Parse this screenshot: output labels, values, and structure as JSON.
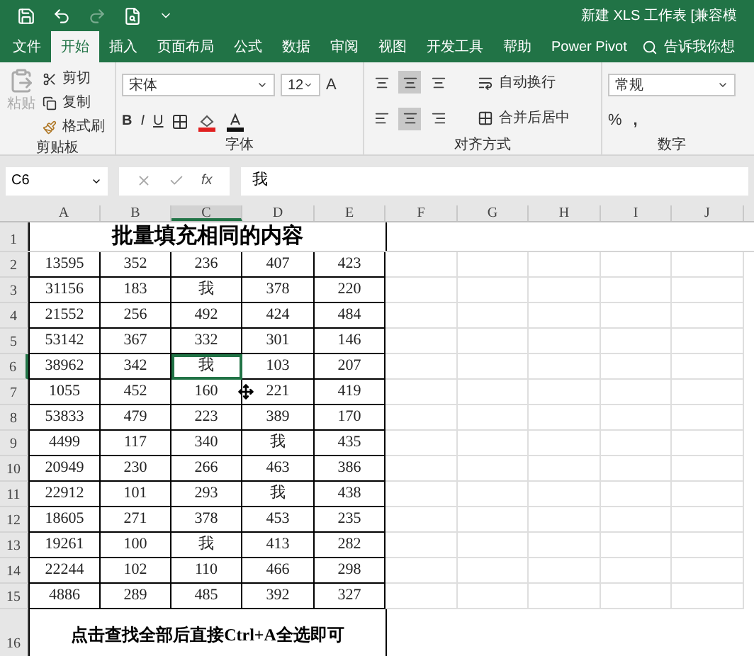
{
  "title_bar": {
    "title": "新建 XLS 工作表 [兼容模"
  },
  "tabs": [
    {
      "label": "文件",
      "selected": false
    },
    {
      "label": "开始",
      "selected": true
    },
    {
      "label": "插入",
      "selected": false
    },
    {
      "label": "页面布局",
      "selected": false
    },
    {
      "label": "公式",
      "selected": false
    },
    {
      "label": "数据",
      "selected": false
    },
    {
      "label": "审阅",
      "selected": false
    },
    {
      "label": "视图",
      "selected": false
    },
    {
      "label": "开发工具",
      "selected": false
    },
    {
      "label": "帮助",
      "selected": false
    },
    {
      "label": "Power Pivot",
      "selected": false
    }
  ],
  "tell_me": {
    "placeholder": "告诉我你想"
  },
  "ribbon": {
    "clipboard": {
      "paste": "粘贴",
      "cut": "剪切",
      "copy": "复制",
      "format_painter": "格式刷",
      "label": "剪贴板"
    },
    "font": {
      "name": "宋体",
      "size": "12",
      "grow": "A",
      "bold": "B",
      "italic": "I",
      "underline": "U",
      "label": "字体"
    },
    "alignment": {
      "middle_on": true,
      "center_on": true,
      "wrap": "自动换行",
      "merge": "合并后居中",
      "label": "对齐方式"
    },
    "number": {
      "format": "常规",
      "percent": "%",
      "comma": ",",
      "label": "数字"
    }
  },
  "formula_bar": {
    "name_box": "C6",
    "fx": "fx",
    "value": "我"
  },
  "sheet": {
    "columns": [
      {
        "label": "A",
        "selected": false
      },
      {
        "label": "B",
        "selected": false
      },
      {
        "label": "C",
        "selected": true
      },
      {
        "label": "D",
        "selected": false
      },
      {
        "label": "E",
        "selected": false
      },
      {
        "label": "F",
        "selected": false
      },
      {
        "label": "G",
        "selected": false
      },
      {
        "label": "H",
        "selected": false
      },
      {
        "label": "I",
        "selected": false
      },
      {
        "label": "J",
        "selected": false
      }
    ],
    "title_row": {
      "header": "1",
      "text": "批量填充相同的内容"
    },
    "rows": [
      {
        "header": "2",
        "selected": false,
        "cells": [
          "13595",
          "352",
          "236",
          "407",
          "423"
        ]
      },
      {
        "header": "3",
        "selected": false,
        "cells": [
          "31156",
          "183",
          "我",
          "378",
          "220"
        ]
      },
      {
        "header": "4",
        "selected": false,
        "cells": [
          "21552",
          "256",
          "492",
          "424",
          "484"
        ]
      },
      {
        "header": "5",
        "selected": false,
        "cells": [
          "53142",
          "367",
          "332",
          "301",
          "146"
        ]
      },
      {
        "header": "6",
        "selected": true,
        "cells": [
          "38962",
          "342",
          "我",
          "103",
          "207"
        ]
      },
      {
        "header": "7",
        "selected": false,
        "cells": [
          "1055",
          "452",
          "160",
          "221",
          "419"
        ]
      },
      {
        "header": "8",
        "selected": false,
        "cells": [
          "53833",
          "479",
          "223",
          "389",
          "170"
        ]
      },
      {
        "header": "9",
        "selected": false,
        "cells": [
          "4499",
          "117",
          "340",
          "我",
          "435"
        ]
      },
      {
        "header": "10",
        "selected": false,
        "cells": [
          "20949",
          "230",
          "266",
          "463",
          "386"
        ]
      },
      {
        "header": "11",
        "selected": false,
        "cells": [
          "22912",
          "101",
          "293",
          "我",
          "438"
        ]
      },
      {
        "header": "12",
        "selected": false,
        "cells": [
          "18605",
          "271",
          "378",
          "453",
          "235"
        ]
      },
      {
        "header": "13",
        "selected": false,
        "cells": [
          "19261",
          "100",
          "我",
          "413",
          "282"
        ]
      },
      {
        "header": "14",
        "selected": false,
        "cells": [
          "22244",
          "102",
          "110",
          "466",
          "298"
        ]
      },
      {
        "header": "15",
        "selected": false,
        "cells": [
          "4886",
          "289",
          "485",
          "392",
          "327"
        ]
      }
    ],
    "footer_row": {
      "header": "16",
      "text": "点击查找全部后直接Ctrl+A全选即可"
    }
  }
}
